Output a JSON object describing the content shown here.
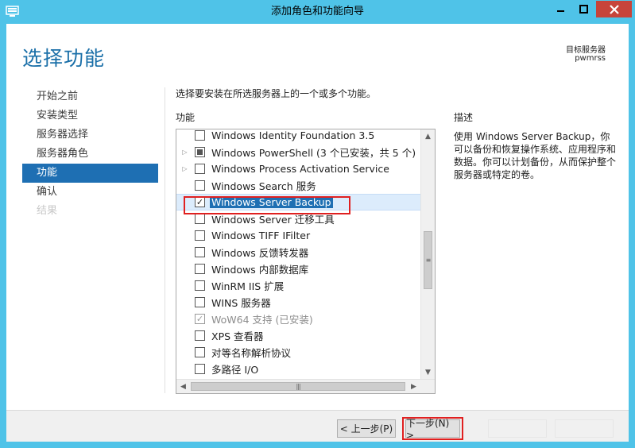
{
  "window": {
    "title": "添加角色和功能向导",
    "accent_color": "#4fc3e8",
    "close_color": "#c7443a",
    "app_icon": "server-manager-icon"
  },
  "header": {
    "page_title": "选择功能",
    "server_label": "目标服务器",
    "server_name": "pwmrss"
  },
  "nav": {
    "items": [
      {
        "label": "开始之前",
        "state": "normal"
      },
      {
        "label": "安装类型",
        "state": "normal"
      },
      {
        "label": "服务器选择",
        "state": "normal"
      },
      {
        "label": "服务器角色",
        "state": "normal"
      },
      {
        "label": "功能",
        "state": "active"
      },
      {
        "label": "确认",
        "state": "normal"
      },
      {
        "label": "结果",
        "state": "disabled"
      }
    ],
    "active_color": "#1e6fb3"
  },
  "main": {
    "instruction": "选择要安装在所选服务器上的一个或多个功能。",
    "features_header": "功能",
    "features": [
      {
        "label": "Windows Identity Foundation 3.5",
        "checked": false,
        "expander": false
      },
      {
        "label": "Windows PowerShell (3 个已安装，共 5 个)",
        "checked": "partial",
        "expander": true
      },
      {
        "label": "Windows Process Activation Service",
        "checked": false,
        "expander": true
      },
      {
        "label": "Windows Search 服务",
        "checked": false,
        "expander": false
      },
      {
        "label": "Windows Server Backup",
        "checked": true,
        "expander": false,
        "selected": true
      },
      {
        "label": "Windows Server 迁移工具",
        "checked": false,
        "expander": false
      },
      {
        "label": "Windows TIFF IFilter",
        "checked": false,
        "expander": false
      },
      {
        "label": "Windows 反馈转发器",
        "checked": false,
        "expander": false
      },
      {
        "label": "Windows 内部数据库",
        "checked": false,
        "expander": false
      },
      {
        "label": "WinRM IIS 扩展",
        "checked": false,
        "expander": false
      },
      {
        "label": "WINS 服务器",
        "checked": false,
        "expander": false
      },
      {
        "label": "WoW64 支持 (已安装)",
        "checked": true,
        "expander": false,
        "disabled": true
      },
      {
        "label": "XPS 查看器",
        "checked": false,
        "expander": false
      },
      {
        "label": "对等名称解析协议",
        "checked": false,
        "expander": false
      },
      {
        "label": "多路径 I/O",
        "checked": false,
        "expander": false
      }
    ],
    "description_header": "描述",
    "description_text": "使用 Windows Server Backup，你可以备份和恢复操作系统、应用程序和数据。你可以计划备份，从而保护整个服务器或特定的卷。"
  },
  "footer": {
    "prev_label": "< 上一步(P)",
    "next_label": "下一步(N) >"
  },
  "highlight_color": "#e02020"
}
